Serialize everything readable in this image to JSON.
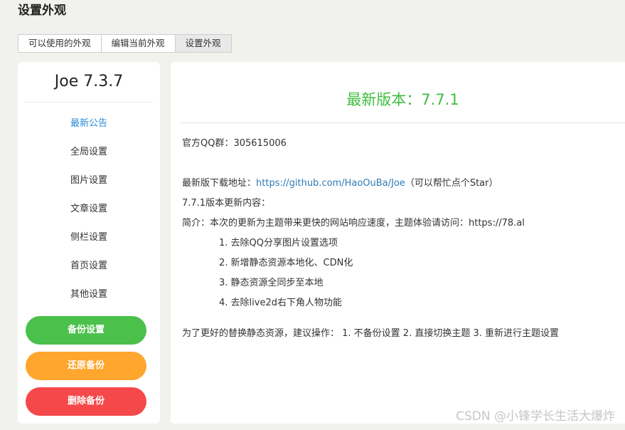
{
  "page": {
    "title": "设置外观"
  },
  "tabs": [
    {
      "label": "可以使用的外观"
    },
    {
      "label": "编辑当前外观"
    },
    {
      "label": "设置外观"
    }
  ],
  "sidebar": {
    "title": "Joe 7.3.7",
    "items": [
      {
        "label": "最新公告"
      },
      {
        "label": "全局设置"
      },
      {
        "label": "图片设置"
      },
      {
        "label": "文章设置"
      },
      {
        "label": "侧栏设置"
      },
      {
        "label": "首页设置"
      },
      {
        "label": "其他设置"
      }
    ],
    "buttons": {
      "backup": "备份设置",
      "restore": "还原备份",
      "delete": "删除备份"
    }
  },
  "main": {
    "heading": "最新版本：7.7.1",
    "qq_group": "官方QQ群：305615006",
    "download_prefix": "最新版下载地址：",
    "download_link": "https://github.com/HaoOuBa/Joe",
    "download_suffix": "（可以帮忙点个Star）",
    "update_title": "7.7.1版本更新内容：",
    "intro": "简介：本次的更新为主题带来更快的网站响应速度，主题体验请访问：https://78.al",
    "changes": [
      "1. 去除QQ分享图片设置选项",
      "2. 新增静态资源本地化、CDN化",
      "3. 静态资源全同步至本地",
      "4. 去除live2d右下角人物功能"
    ],
    "advice": "为了更好的替换静态资源，建议操作：  1. 不备份设置 2. 直接切换主题 3. 重新进行主题设置"
  },
  "watermark": "CSDN @小锋学长生活大爆炸",
  "colors": {
    "accent_link": "#2e8bd8",
    "heading_green": "#3fbf3f",
    "backup_green": "#4bc04b",
    "restore_orange": "#ffa62e",
    "delete_red": "#f5484a"
  }
}
